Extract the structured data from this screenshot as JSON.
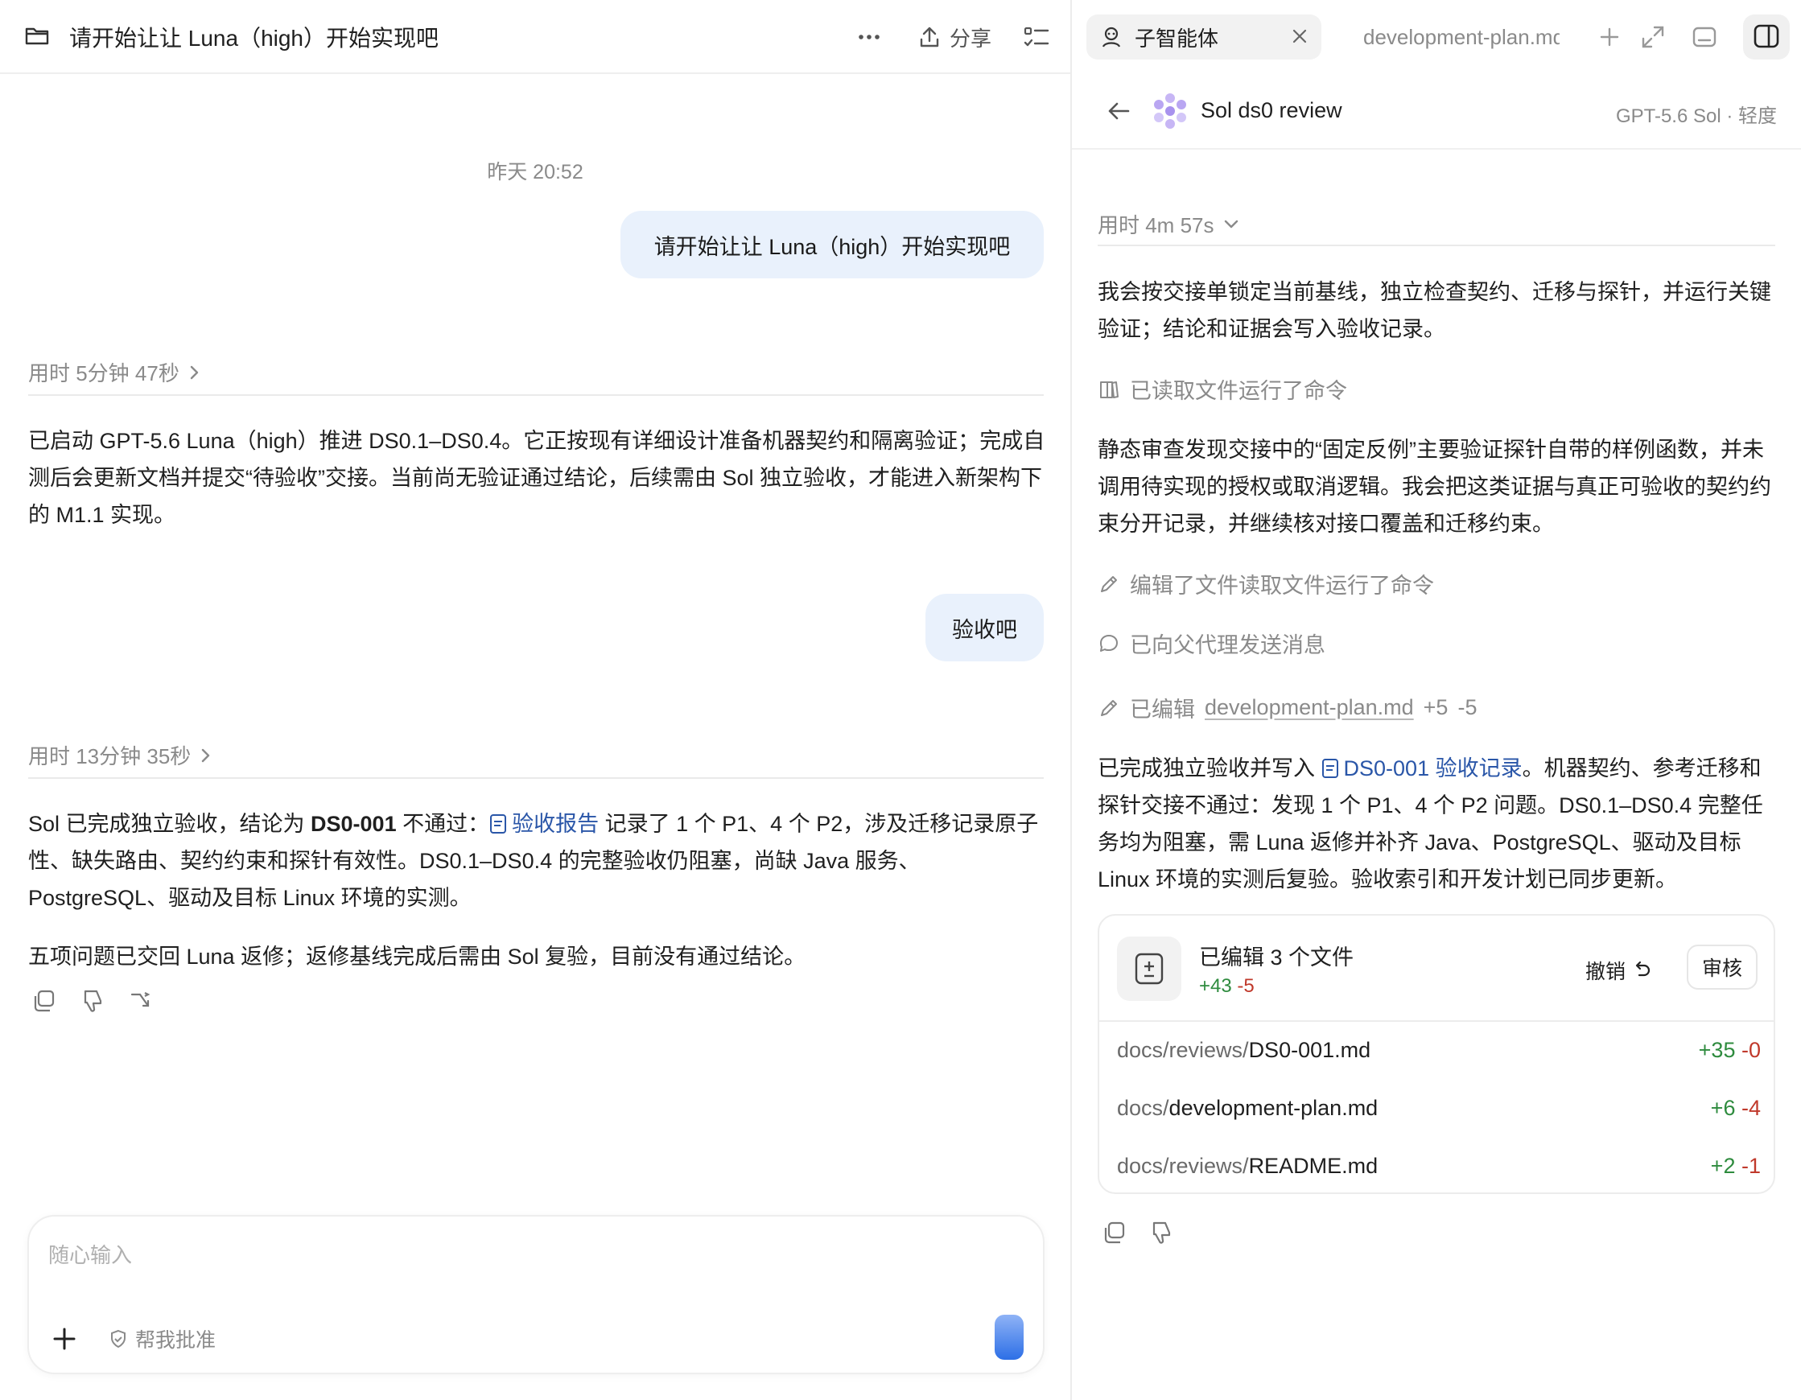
{
  "left": {
    "header": {
      "title": "请开始让让 Luna（high）开始实现吧",
      "share_label": "分享"
    },
    "timestamp": "昨天 20:52",
    "user_msg_1": "请开始让让 Luna（high）开始实现吧",
    "dur_1": "用时 5分钟 47秒",
    "reply_1": "已启动 GPT-5.6 Luna（high）推进 DS0.1–DS0.4。它正按现有详细设计准备机器契约和隔离验证；完成自测后会更新文档并提交“待验收”交接。当前尚无验证通过结论，后续需由 Sol 独立验收，才能进入新架构下的 M1.1 实现。",
    "user_msg_2": "验收吧",
    "dur_2": "用时 13分钟 35秒",
    "reply_2": {
      "p1_a": "Sol 已完成独立验收，结论为 ",
      "p1_bold": "DS0-001",
      "p1_b": " 不通过：",
      "p1_link": "验收报告",
      "p1_c": " 记录了 1 个 P1、4 个 P2，涉及迁移记录原子性、缺失路由、契约约束和探针有效性。DS0.1–DS0.4 的完整验收仍阻塞，尚缺 Java 服务、PostgreSQL、驱动及目标 Linux 环境的实测。",
      "p2": "五项问题已交回 Luna 返修；返修基线完成后需由 Sol 复验，目前没有通过结论。"
    },
    "composer": {
      "placeholder": "随心输入",
      "approve_label": "帮我批准"
    }
  },
  "right": {
    "tabs": [
      {
        "label": "子智能体"
      },
      {
        "label": "development-plan.md"
      }
    ],
    "agent": {
      "name": "Sol ds0 review",
      "model": "GPT-5.6 Sol · 轻度"
    },
    "dur": "用时 4m 57s",
    "intro": "我会按交接单锁定当前基线，独立检查契约、迁移与探针，并运行关键验证；结论和证据会写入验收记录。",
    "tool_1": "已读取文件运行了命令",
    "finding": "静态审查发现交接中的“固定反例”主要验证探针自带的样例函数，并未调用待实现的授权或取消逻辑。我会把这类证据与真正可验收的契约约束分开记录，并继续核对接口覆盖和迁移约束。",
    "tool_2": "编辑了文件读取文件运行了命令",
    "tool_3": "已向父代理发送消息",
    "tool_4": {
      "prefix": "已编辑",
      "file": "development-plan.md",
      "plus": "+5",
      "minus": "-5"
    },
    "summary": {
      "a": "已完成独立验收并写入 ",
      "link": "DS0-001 验收记录",
      "b": "。机器契约、参考迁移和探针交接不通过：发现 1 个 P1、4 个 P2 问题。DS0.1–DS0.4 完整任务均为阻塞，需 Luna 返修并补齐 Java、PostgreSQL、驱动及目标 Linux 环境的实测后复验。验收索引和开发计划已同步更新。"
    },
    "files_card": {
      "title": "已编辑 3 个文件",
      "plus": "+43",
      "minus": "-5",
      "undo_label": "撤销",
      "review_label": "审核",
      "files": [
        {
          "dir": "docs/reviews/",
          "name": "DS0-001.md",
          "plus": "+35",
          "minus": "-0"
        },
        {
          "dir": "docs/",
          "name": "development-plan.md",
          "plus": "+6",
          "minus": "-4"
        },
        {
          "dir": "docs/reviews/",
          "name": "README.md",
          "plus": "+2",
          "minus": "-1"
        }
      ]
    }
  }
}
